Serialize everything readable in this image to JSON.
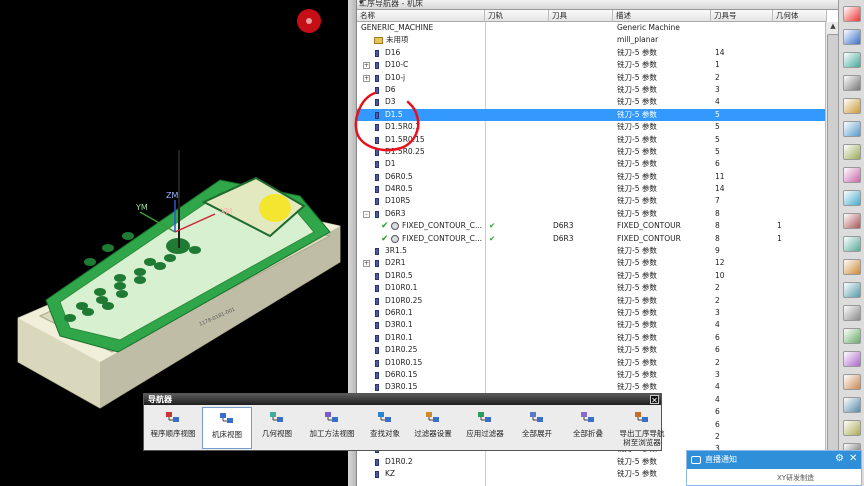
{
  "navigator": {
    "title": "工序导航器 - 机床",
    "columns": [
      "名称",
      "刀轨",
      "刀具",
      "描述",
      "刀具号",
      "几何体"
    ],
    "rows": [
      {
        "name": "GENERIC_MACHINE",
        "path": "",
        "tool": "",
        "desc": "Generic Machine",
        "toolno": "",
        "geom": "",
        "indent": 0,
        "icon": "none"
      },
      {
        "name": "未用项",
        "path": "",
        "tool": "",
        "desc": "mill_planar",
        "toolno": "",
        "geom": "",
        "indent": 1,
        "icon": "folder"
      },
      {
        "name": "D16",
        "path": "",
        "tool": "",
        "desc": "铣刀-5 参数",
        "toolno": "14",
        "geom": "",
        "indent": 1,
        "icon": "tool"
      },
      {
        "name": "D10-C",
        "path": "",
        "tool": "",
        "desc": "铣刀-5 参数",
        "toolno": "1",
        "geom": "",
        "indent": 1,
        "icon": "tool",
        "exp": "+"
      },
      {
        "name": "D10-j",
        "path": "",
        "tool": "",
        "desc": "铣刀-5 参数",
        "toolno": "2",
        "geom": "",
        "indent": 1,
        "icon": "tool",
        "exp": "+"
      },
      {
        "name": "D6",
        "path": "",
        "tool": "",
        "desc": "铣刀-5 参数",
        "toolno": "3",
        "geom": "",
        "indent": 1,
        "icon": "tool"
      },
      {
        "name": "D3",
        "path": "",
        "tool": "",
        "desc": "铣刀-5 参数",
        "toolno": "4",
        "geom": "",
        "indent": 1,
        "icon": "tool"
      },
      {
        "name": "D1.5",
        "path": "",
        "tool": "",
        "desc": "铣刀-5 参数",
        "toolno": "5",
        "geom": "",
        "indent": 1,
        "icon": "tool",
        "sel": true
      },
      {
        "name": "D1.5R0.1",
        "path": "",
        "tool": "",
        "desc": "铣刀-5 参数",
        "toolno": "5",
        "geom": "",
        "indent": 1,
        "icon": "tool"
      },
      {
        "name": "D1.5R0.15",
        "path": "",
        "tool": "",
        "desc": "铣刀-5 参数",
        "toolno": "5",
        "geom": "",
        "indent": 1,
        "icon": "tool"
      },
      {
        "name": "D1.5R0.25",
        "path": "",
        "tool": "",
        "desc": "铣刀-5 参数",
        "toolno": "5",
        "geom": "",
        "indent": 1,
        "icon": "tool"
      },
      {
        "name": "D1",
        "path": "",
        "tool": "",
        "desc": "铣刀-5 参数",
        "toolno": "6",
        "geom": "",
        "indent": 1,
        "icon": "tool"
      },
      {
        "name": "D6R0.5",
        "path": "",
        "tool": "",
        "desc": "铣刀-5 参数",
        "toolno": "11",
        "geom": "",
        "indent": 1,
        "icon": "tool"
      },
      {
        "name": "D4R0.5",
        "path": "",
        "tool": "",
        "desc": "铣刀-5 参数",
        "toolno": "14",
        "geom": "",
        "indent": 1,
        "icon": "tool"
      },
      {
        "name": "D10R5",
        "path": "",
        "tool": "",
        "desc": "铣刀-5 参数",
        "toolno": "7",
        "geom": "",
        "indent": 1,
        "icon": "tool"
      },
      {
        "name": "D6R3",
        "path": "",
        "tool": "",
        "desc": "铣刀-5 参数",
        "toolno": "8",
        "geom": "",
        "indent": 1,
        "icon": "tool",
        "exp": "-"
      },
      {
        "name": "FIXED_CONTOUR_C...",
        "path": "✔",
        "tool": "D6R3",
        "desc": "FIXED_CONTOUR",
        "toolno": "8",
        "geom": "1",
        "indent": 2,
        "icon": "op"
      },
      {
        "name": "FIXED_CONTOUR_C...",
        "path": "✔",
        "tool": "D6R3",
        "desc": "FIXED_CONTOUR",
        "toolno": "8",
        "geom": "1",
        "indent": 2,
        "icon": "op"
      },
      {
        "name": "3R1.5",
        "path": "",
        "tool": "",
        "desc": "铣刀-5 参数",
        "toolno": "9",
        "geom": "",
        "indent": 1,
        "icon": "tool"
      },
      {
        "name": "D2R1",
        "path": "",
        "tool": "",
        "desc": "铣刀-5 参数",
        "toolno": "12",
        "geom": "",
        "indent": 1,
        "icon": "tool",
        "exp": "+"
      },
      {
        "name": "D1R0.5",
        "path": "",
        "tool": "",
        "desc": "铣刀-5 参数",
        "toolno": "10",
        "geom": "",
        "indent": 1,
        "icon": "tool"
      },
      {
        "name": "D10R0.1",
        "path": "",
        "tool": "",
        "desc": "铣刀-5 参数",
        "toolno": "2",
        "geom": "",
        "indent": 1,
        "icon": "tool"
      },
      {
        "name": "D10R0.25",
        "path": "",
        "tool": "",
        "desc": "铣刀-5 参数",
        "toolno": "2",
        "geom": "",
        "indent": 1,
        "icon": "tool"
      },
      {
        "name": "D6R0.1",
        "path": "",
        "tool": "",
        "desc": "铣刀-5 参数",
        "toolno": "3",
        "geom": "",
        "indent": 1,
        "icon": "tool"
      },
      {
        "name": "D3R0.1",
        "path": "",
        "tool": "",
        "desc": "铣刀-5 参数",
        "toolno": "4",
        "geom": "",
        "indent": 1,
        "icon": "tool"
      },
      {
        "name": "D1R0.1",
        "path": "",
        "tool": "",
        "desc": "铣刀-5 参数",
        "toolno": "6",
        "geom": "",
        "indent": 1,
        "icon": "tool"
      },
      {
        "name": "D1R0.25",
        "path": "",
        "tool": "",
        "desc": "铣刀-5 参数",
        "toolno": "6",
        "geom": "",
        "indent": 1,
        "icon": "tool"
      },
      {
        "name": "D10R0.15",
        "path": "",
        "tool": "",
        "desc": "铣刀-5 参数",
        "toolno": "2",
        "geom": "",
        "indent": 1,
        "icon": "tool"
      },
      {
        "name": "D6R0.15",
        "path": "",
        "tool": "",
        "desc": "铣刀-5 参数",
        "toolno": "3",
        "geom": "",
        "indent": 1,
        "icon": "tool"
      },
      {
        "name": "D3R0.15",
        "path": "",
        "tool": "",
        "desc": "铣刀-5 参数",
        "toolno": "4",
        "geom": "",
        "indent": 1,
        "icon": "tool"
      },
      {
        "name": "",
        "path": "",
        "tool": "",
        "desc": "",
        "toolno": "4",
        "geom": "",
        "indent": 1,
        "icon": "none"
      },
      {
        "name": "",
        "path": "",
        "tool": "",
        "desc": "",
        "toolno": "6",
        "geom": "",
        "indent": 1,
        "icon": "none"
      },
      {
        "name": "",
        "path": "",
        "tool": "",
        "desc": "",
        "toolno": "6",
        "geom": "",
        "indent": 1,
        "icon": "none"
      },
      {
        "name": "",
        "path": "",
        "tool": "",
        "desc": "",
        "toolno": "2",
        "geom": "",
        "indent": 1,
        "icon": "none"
      },
      {
        "name": "D3R0.2",
        "path": "",
        "tool": "",
        "desc": "铣刀-5 参数",
        "toolno": "3",
        "geom": "",
        "indent": 1,
        "icon": "tool"
      },
      {
        "name": "D1R0.2",
        "path": "",
        "tool": "",
        "desc": "铣刀-5 参数",
        "toolno": "",
        "geom": "",
        "indent": 1,
        "icon": "tool"
      },
      {
        "name": "KZ",
        "path": "",
        "tool": "",
        "desc": "铣刀-5 参数",
        "toolno": "",
        "geom": "",
        "indent": 1,
        "icon": "tool"
      }
    ]
  },
  "viewport": {
    "axis_labels": {
      "ym": "YM",
      "zm": "ZM",
      "xm": "XM"
    },
    "part_engraving": "1178-0181-001"
  },
  "toolbar": {
    "title": "导航器",
    "close": "✕",
    "buttons": [
      {
        "label": "程序顺序视图",
        "icon": "program-order-icon"
      },
      {
        "label": "机床视图",
        "icon": "machine-tool-icon",
        "active": true
      },
      {
        "label": "几何视图",
        "icon": "geometry-icon"
      },
      {
        "label": "加工方法视图",
        "icon": "method-icon"
      },
      {
        "label": "查找对象",
        "icon": "find-icon"
      },
      {
        "label": "过滤器设置",
        "icon": "filter-settings-icon"
      },
      {
        "label": "应用过滤器",
        "icon": "apply-filter-icon"
      },
      {
        "label": "全部展开",
        "icon": "expand-all-icon"
      },
      {
        "label": "全部折叠",
        "icon": "collapse-all-icon"
      },
      {
        "label": "导出工序导航\n树至浏览器",
        "icon": "export-icon"
      }
    ]
  },
  "chat": {
    "title": "直播通知",
    "sub": "XY研发制造"
  },
  "colors": {
    "selection": "#3399ff",
    "part_green": "#2fa64a",
    "annotation_red": "#e8101a"
  }
}
